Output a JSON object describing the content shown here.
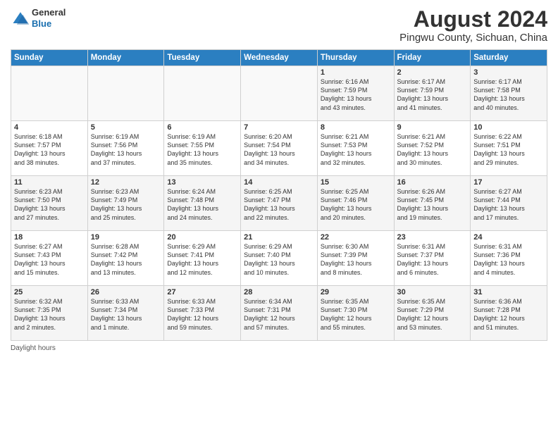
{
  "header": {
    "logo_general": "General",
    "logo_blue": "Blue",
    "month_year": "August 2024",
    "location": "Pingwu County, Sichuan, China"
  },
  "weekdays": [
    "Sunday",
    "Monday",
    "Tuesday",
    "Wednesday",
    "Thursday",
    "Friday",
    "Saturday"
  ],
  "weeks": [
    [
      {
        "day": "",
        "info": ""
      },
      {
        "day": "",
        "info": ""
      },
      {
        "day": "",
        "info": ""
      },
      {
        "day": "",
        "info": ""
      },
      {
        "day": "1",
        "info": "Sunrise: 6:16 AM\nSunset: 7:59 PM\nDaylight: 13 hours\nand 43 minutes."
      },
      {
        "day": "2",
        "info": "Sunrise: 6:17 AM\nSunset: 7:59 PM\nDaylight: 13 hours\nand 41 minutes."
      },
      {
        "day": "3",
        "info": "Sunrise: 6:17 AM\nSunset: 7:58 PM\nDaylight: 13 hours\nand 40 minutes."
      }
    ],
    [
      {
        "day": "4",
        "info": "Sunrise: 6:18 AM\nSunset: 7:57 PM\nDaylight: 13 hours\nand 38 minutes."
      },
      {
        "day": "5",
        "info": "Sunrise: 6:19 AM\nSunset: 7:56 PM\nDaylight: 13 hours\nand 37 minutes."
      },
      {
        "day": "6",
        "info": "Sunrise: 6:19 AM\nSunset: 7:55 PM\nDaylight: 13 hours\nand 35 minutes."
      },
      {
        "day": "7",
        "info": "Sunrise: 6:20 AM\nSunset: 7:54 PM\nDaylight: 13 hours\nand 34 minutes."
      },
      {
        "day": "8",
        "info": "Sunrise: 6:21 AM\nSunset: 7:53 PM\nDaylight: 13 hours\nand 32 minutes."
      },
      {
        "day": "9",
        "info": "Sunrise: 6:21 AM\nSunset: 7:52 PM\nDaylight: 13 hours\nand 30 minutes."
      },
      {
        "day": "10",
        "info": "Sunrise: 6:22 AM\nSunset: 7:51 PM\nDaylight: 13 hours\nand 29 minutes."
      }
    ],
    [
      {
        "day": "11",
        "info": "Sunrise: 6:23 AM\nSunset: 7:50 PM\nDaylight: 13 hours\nand 27 minutes."
      },
      {
        "day": "12",
        "info": "Sunrise: 6:23 AM\nSunset: 7:49 PM\nDaylight: 13 hours\nand 25 minutes."
      },
      {
        "day": "13",
        "info": "Sunrise: 6:24 AM\nSunset: 7:48 PM\nDaylight: 13 hours\nand 24 minutes."
      },
      {
        "day": "14",
        "info": "Sunrise: 6:25 AM\nSunset: 7:47 PM\nDaylight: 13 hours\nand 22 minutes."
      },
      {
        "day": "15",
        "info": "Sunrise: 6:25 AM\nSunset: 7:46 PM\nDaylight: 13 hours\nand 20 minutes."
      },
      {
        "day": "16",
        "info": "Sunrise: 6:26 AM\nSunset: 7:45 PM\nDaylight: 13 hours\nand 19 minutes."
      },
      {
        "day": "17",
        "info": "Sunrise: 6:27 AM\nSunset: 7:44 PM\nDaylight: 13 hours\nand 17 minutes."
      }
    ],
    [
      {
        "day": "18",
        "info": "Sunrise: 6:27 AM\nSunset: 7:43 PM\nDaylight: 13 hours\nand 15 minutes."
      },
      {
        "day": "19",
        "info": "Sunrise: 6:28 AM\nSunset: 7:42 PM\nDaylight: 13 hours\nand 13 minutes."
      },
      {
        "day": "20",
        "info": "Sunrise: 6:29 AM\nSunset: 7:41 PM\nDaylight: 13 hours\nand 12 minutes."
      },
      {
        "day": "21",
        "info": "Sunrise: 6:29 AM\nSunset: 7:40 PM\nDaylight: 13 hours\nand 10 minutes."
      },
      {
        "day": "22",
        "info": "Sunrise: 6:30 AM\nSunset: 7:39 PM\nDaylight: 13 hours\nand 8 minutes."
      },
      {
        "day": "23",
        "info": "Sunrise: 6:31 AM\nSunset: 7:37 PM\nDaylight: 13 hours\nand 6 minutes."
      },
      {
        "day": "24",
        "info": "Sunrise: 6:31 AM\nSunset: 7:36 PM\nDaylight: 13 hours\nand 4 minutes."
      }
    ],
    [
      {
        "day": "25",
        "info": "Sunrise: 6:32 AM\nSunset: 7:35 PM\nDaylight: 13 hours\nand 2 minutes."
      },
      {
        "day": "26",
        "info": "Sunrise: 6:33 AM\nSunset: 7:34 PM\nDaylight: 13 hours\nand 1 minute."
      },
      {
        "day": "27",
        "info": "Sunrise: 6:33 AM\nSunset: 7:33 PM\nDaylight: 12 hours\nand 59 minutes."
      },
      {
        "day": "28",
        "info": "Sunrise: 6:34 AM\nSunset: 7:31 PM\nDaylight: 12 hours\nand 57 minutes."
      },
      {
        "day": "29",
        "info": "Sunrise: 6:35 AM\nSunset: 7:30 PM\nDaylight: 12 hours\nand 55 minutes."
      },
      {
        "day": "30",
        "info": "Sunrise: 6:35 AM\nSunset: 7:29 PM\nDaylight: 12 hours\nand 53 minutes."
      },
      {
        "day": "31",
        "info": "Sunrise: 6:36 AM\nSunset: 7:28 PM\nDaylight: 12 hours\nand 51 minutes."
      }
    ]
  ],
  "footer": {
    "daylight_label": "Daylight hours"
  }
}
